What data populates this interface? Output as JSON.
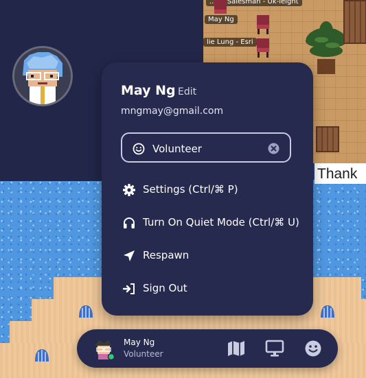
{
  "world": {
    "name_tag_1": "May Ng",
    "name_tag_2": "lie Lung - Esri",
    "name_tag_top": "...ral Salesman - Uk-leight",
    "board_text": "Thank"
  },
  "profile_menu": {
    "user_name": "May Ng",
    "edit_label": "Edit",
    "email": "mngmay@gmail.com",
    "status": {
      "value": "Volunteer",
      "icon": "smile-icon",
      "clear_icon": "clear-circle-icon"
    },
    "items": [
      {
        "label": "Settings (Ctrl/⌘ P)",
        "icon": "gear-icon"
      },
      {
        "label": "Turn On Quiet Mode (Ctrl/⌘ U)",
        "icon": "headphones-icon"
      },
      {
        "label": "Respawn",
        "icon": "location-arrow-icon"
      },
      {
        "label": "Sign Out",
        "icon": "sign-out-icon"
      }
    ]
  },
  "bottom_bar": {
    "name": "May Ng",
    "status": "Volunteer",
    "buttons": [
      "map-icon",
      "screen-share-icon",
      "emote-icon"
    ]
  },
  "colors": {
    "panel": "#272a4f",
    "dark_room": "#222648",
    "water": "#4f97e0",
    "sand": "#f0c89a",
    "online_dot": "#2ecc71"
  }
}
